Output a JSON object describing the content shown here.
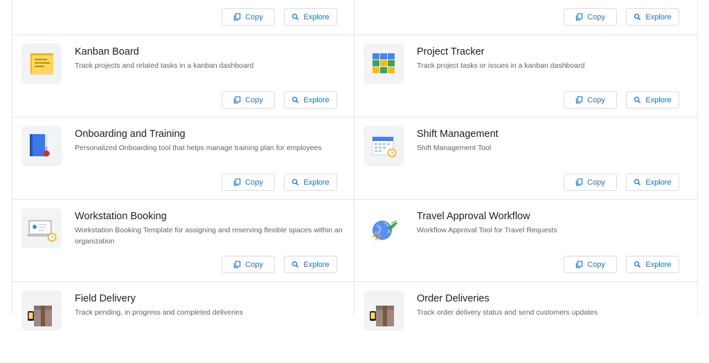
{
  "buttons": {
    "copy": "Copy",
    "explore": "Explore"
  },
  "tiles": [
    {
      "title": "",
      "description": "",
      "icon": "none"
    },
    {
      "title": "",
      "description": "",
      "icon": "none"
    },
    {
      "title": "Kanban Board",
      "description": "Track projects and related tasks in a kanban dashboard",
      "icon": "sticky-notes-icon"
    },
    {
      "title": "Project Tracker",
      "description": "Track project tasks or issues in a kanban dashboard",
      "icon": "color-grid-icon"
    },
    {
      "title": "Onboarding and Training",
      "description": "Personalized Onboarding tool that helps manage training plan for employees",
      "icon": "binder-icon"
    },
    {
      "title": "Shift Management",
      "description": "Shift Management Tool",
      "icon": "calendar-clock-icon"
    },
    {
      "title": "Workstation Booking",
      "description": "Workstation Booking Template for assigning and reserving flexible spaces within an organization",
      "icon": "laptop-clock-icon"
    },
    {
      "title": "Travel Approval Workflow",
      "description": "Workflow Approval Tool for Travel Requests",
      "icon": "globe-plane-icon"
    },
    {
      "title": "Field Delivery",
      "description": "Track pending, in progress and completed deliveries",
      "icon": "package-icon"
    },
    {
      "title": "Order Deliveries",
      "description": "Track order delivery status and send customers updates",
      "icon": "package-icon"
    }
  ]
}
